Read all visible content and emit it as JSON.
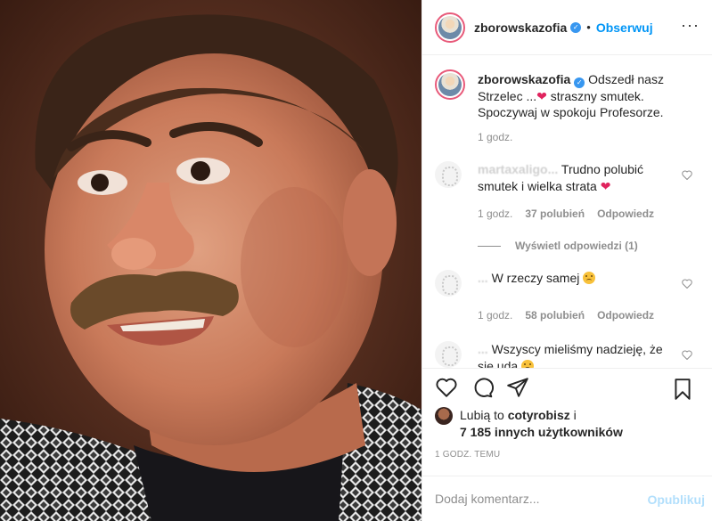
{
  "post": {
    "author": "zborowskazofia",
    "dot": "•",
    "follow_label": "Obserwuj",
    "more_icon": "more-icon"
  },
  "caption": {
    "username": "zborowskazofia",
    "text_part1": "Odszedł nasz Strzelec ...",
    "text_part2": " straszny smutek. Spoczywaj w spokoju Profesorze.",
    "time": "1 godz."
  },
  "comments": [
    {
      "username": "martaxaligo...",
      "text": "Trudno polubić smutek i wielka strata",
      "time": "1 godz.",
      "likes": "37 polubień",
      "reply_label": "Odpowiedz",
      "view_replies": "Wyświetl odpowiedzi (1)"
    },
    {
      "username": "...",
      "text": "W rzeczy samej",
      "time": "1 godz.",
      "likes": "58 polubień",
      "reply_label": "Odpowiedz"
    },
    {
      "username": "...",
      "text": "Wszyscy mieliśmy nadzieję, że się uda"
    }
  ],
  "likes": {
    "prefix": "Lubią to",
    "user": "cotyrobisz",
    "suffix": "i",
    "others": "7 185 innych użytkowników"
  },
  "time_ago": "1 godz. temu",
  "comment_box": {
    "placeholder": "Dodaj komentarz...",
    "publish_label": "Opublikuj"
  },
  "colors": {
    "accent": "#0095f6",
    "heart_red": "#e0245e",
    "muted": "#8e8e8e"
  }
}
